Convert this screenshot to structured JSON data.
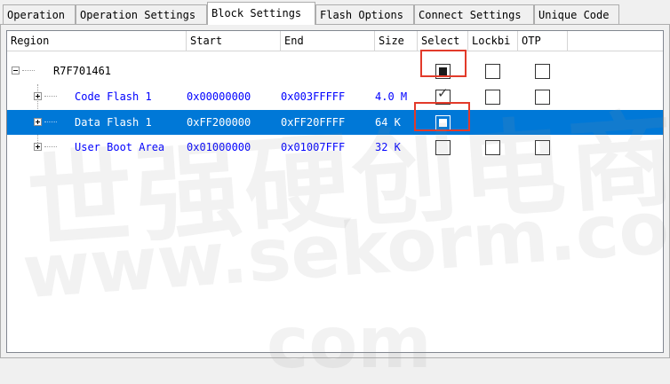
{
  "tabs": [
    {
      "label": "Operation",
      "active": false
    },
    {
      "label": "Operation Settings",
      "active": false
    },
    {
      "label": "Block Settings",
      "active": true
    },
    {
      "label": "Flash Options",
      "active": false
    },
    {
      "label": "Connect Settings",
      "active": false
    },
    {
      "label": "Unique Code",
      "active": false
    }
  ],
  "columns": {
    "region": "Region",
    "start": "Start",
    "end": "End",
    "size": "Size",
    "select": "Select",
    "lockbit": "Lockbi",
    "otp": "OTP"
  },
  "rows": [
    {
      "region": "R7F701461",
      "start": "",
      "end": "",
      "size": "",
      "select": "indeterminate",
      "lockbit": "unchecked",
      "otp": "unchecked",
      "selected": false
    },
    {
      "region": "Code Flash 1",
      "start": "0x00000000",
      "end": "0x003FFFFF",
      "size": "4.0 M",
      "select": "checked",
      "lockbit": "unchecked",
      "otp": "unchecked",
      "selected": false
    },
    {
      "region": "Data Flash 1",
      "start": "0xFF200000",
      "end": "0xFF20FFFF",
      "size": "64 K",
      "select": "indeterminate",
      "lockbit": "none",
      "otp": "none",
      "selected": true
    },
    {
      "region": "User Boot Area",
      "start": "0x01000000",
      "end": "0x01007FFF",
      "size": "32 K",
      "select": "unchecked",
      "lockbit": "unchecked",
      "otp": "unchecked",
      "selected": false
    }
  ],
  "watermark": {
    "line1": "世强硬创电商",
    "line2": "www.sekorm.com",
    "line3": "com"
  },
  "colors": {
    "selection": "#0078d7",
    "annotation": "#e23a2a",
    "child_text": "#0000ff"
  }
}
